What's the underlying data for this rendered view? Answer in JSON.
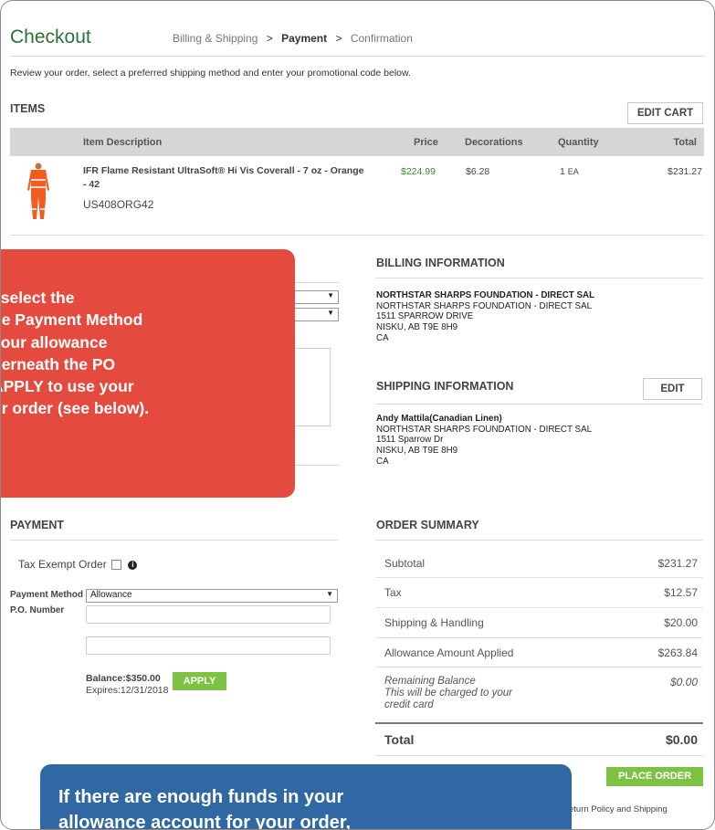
{
  "header": {
    "title": "Checkout",
    "crumb_billing": "Billing & Shipping",
    "crumb_sep1": ">",
    "crumb_payment": "Payment",
    "crumb_sep2": ">",
    "crumb_confirm": "Confirmation"
  },
  "intro": "Review your order, select a preferred shipping method and enter your promotional code below.",
  "items": {
    "heading": "ITEMS",
    "edit_cart": "EDIT CART",
    "columns": {
      "desc": "Item Description",
      "price": "Price",
      "decorations": "Decorations",
      "quantity": "Quantity",
      "total": "Total"
    },
    "row": {
      "name_line1": "IFR Flame Resistant UltraSoft® Hi Vis Coverall - 7 oz - Orange",
      "name_line2": "- 42",
      "sku": "US408ORG42",
      "price": "$224.99",
      "decorations": "$6.28",
      "qty": "1",
      "qty_unit": "EA",
      "total": "$231.27"
    }
  },
  "callout_red": {
    "lines": [
      ", select the",
      "he Payment Method",
      "your allowance",
      "derneath the PO",
      "APPLY to use your",
      "ur order (see below)."
    ]
  },
  "billing": {
    "heading": "BILLING INFORMATION",
    "lines": [
      "NORTHSTAR SHARPS FOUNDATION - DIRECT SAL",
      "NORTHSTAR SHARPS FOUNDATION - DIRECT SAL",
      "1511 SPARROW DRIVE",
      "NISKU, AB T9E 8H9",
      "CA"
    ]
  },
  "shipping": {
    "heading": "SHIPPING INFORMATION",
    "edit": "EDIT",
    "name": "Andy Mattila(Canadian Linen)",
    "lines": [
      "NORTHSTAR SHARPS FOUNDATION - DIRECT SAL",
      "1511 Sparrow Dr",
      "NISKU, AB T9E 8H9",
      "CA"
    ]
  },
  "payment": {
    "heading": "PAYMENT",
    "tax_exempt": "Tax Exempt Order",
    "method_label": "Payment Method",
    "method_value": "Allowance",
    "po_label": "P.O. Number",
    "balance": "Balance:$350.00",
    "expires": "Expires:12/31/2018",
    "apply": "APPLY"
  },
  "summary": {
    "heading": "ORDER SUMMARY",
    "rows": [
      {
        "label": "Subtotal",
        "value": "$231.27"
      },
      {
        "label": "Tax",
        "value": "$12.57"
      },
      {
        "label": "Shipping & Handling",
        "value": "$20.00"
      },
      {
        "label": "Allowance Amount Applied",
        "value": "$263.84"
      }
    ],
    "remaining_label": "Remaining Balance",
    "remaining_note1": "This will be charged to your",
    "remaining_note2": "credit card",
    "remaining_value": "$0.00",
    "total_label": "Total",
    "total_value": "$0.00",
    "place_order": "PLACE ORDER"
  },
  "footer": {
    "policy": "eturn Policy and Shipping"
  },
  "callout_blue": {
    "line1": "If there are enough funds in your",
    "line2": "allowance account for your order,"
  },
  "colors": {
    "title_green": "#2e6f37",
    "price_green": "#3b8a2e",
    "button_green": "#7dc242",
    "callout_red": "#e44a3e",
    "callout_blue": "#2f68a3"
  }
}
